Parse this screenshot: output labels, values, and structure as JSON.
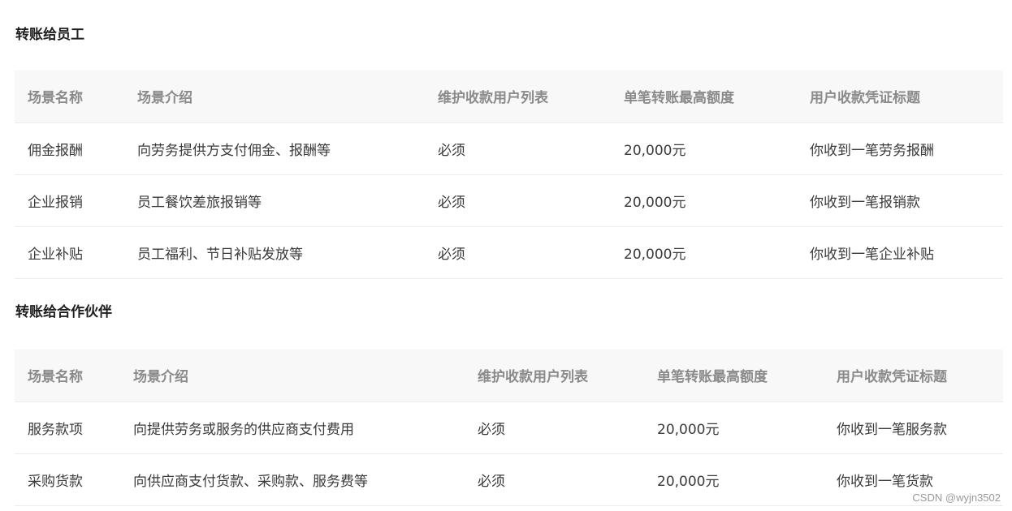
{
  "sections": [
    {
      "title": "转账给员工",
      "headers": [
        "场景名称",
        "场景介绍",
        "维护收款用户列表",
        "单笔转账最高额度",
        "用户收款凭证标题"
      ],
      "rows": [
        [
          "佣金报酬",
          "向劳务提供方支付佣金、报酬等",
          "必须",
          "20,000元",
          "你收到一笔劳务报酬"
        ],
        [
          "企业报销",
          "员工餐饮差旅报销等",
          "必须",
          "20,000元",
          "你收到一笔报销款"
        ],
        [
          "企业补贴",
          "员工福利、节日补贴发放等",
          "必须",
          "20,000元",
          "你收到一笔企业补贴"
        ]
      ]
    },
    {
      "title": "转账给合作伙伴",
      "headers": [
        "场景名称",
        "场景介绍",
        "维护收款用户列表",
        "单笔转账最高额度",
        "用户收款凭证标题"
      ],
      "rows": [
        [
          "服务款项",
          "向提供劳务或服务的供应商支付费用",
          "必须",
          "20,000元",
          "你收到一笔服务款"
        ],
        [
          "采购货款",
          "向供应商支付货款、采购款、服务费等",
          "必须",
          "20,000元",
          "你收到一笔货款"
        ]
      ]
    }
  ],
  "watermark": "CSDN @wyjn3502"
}
